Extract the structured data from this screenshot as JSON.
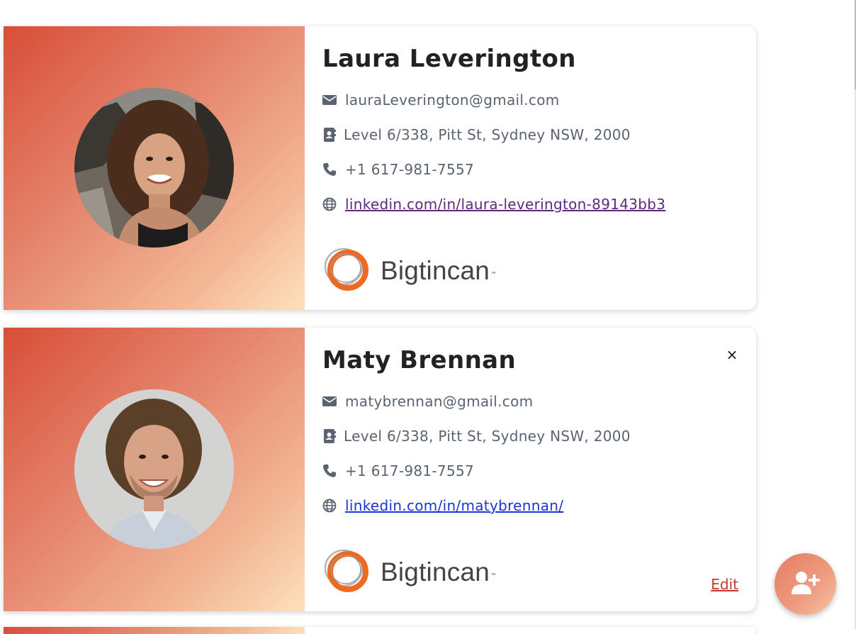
{
  "contacts": [
    {
      "name": "Laura Leverington",
      "email": "lauraLeverington@gmail.com",
      "address": "Level 6/338, Pitt St, Sydney NSW, 2000",
      "phone": "+1 617-981-7557",
      "website": "linkedin.com/in/laura-leverington-89143bb3",
      "company": "Bigtincan"
    },
    {
      "name": "Maty Brennan",
      "email": "matybrennan@gmail.com",
      "address": "Level 6/338, Pitt St, Sydney NSW, 2000",
      "phone": "+1 617-981-7557",
      "website": "linkedin.com/in/matybrennan/",
      "company": "Bigtincan",
      "close_label": "×",
      "edit_label": "Edit"
    }
  ],
  "logo_tm": "™",
  "icons": {
    "email": "envelope-icon",
    "address": "address-book-icon",
    "phone": "phone-icon",
    "website": "globe-icon",
    "fab": "user-plus-icon"
  },
  "colors": {
    "accent": "#d84e38",
    "gradient_end": "#fde1bd",
    "edit": "#c0392b",
    "visited_link": "#5b2a7c",
    "link": "#1a37d2",
    "logo_orange": "#ee6a23"
  }
}
